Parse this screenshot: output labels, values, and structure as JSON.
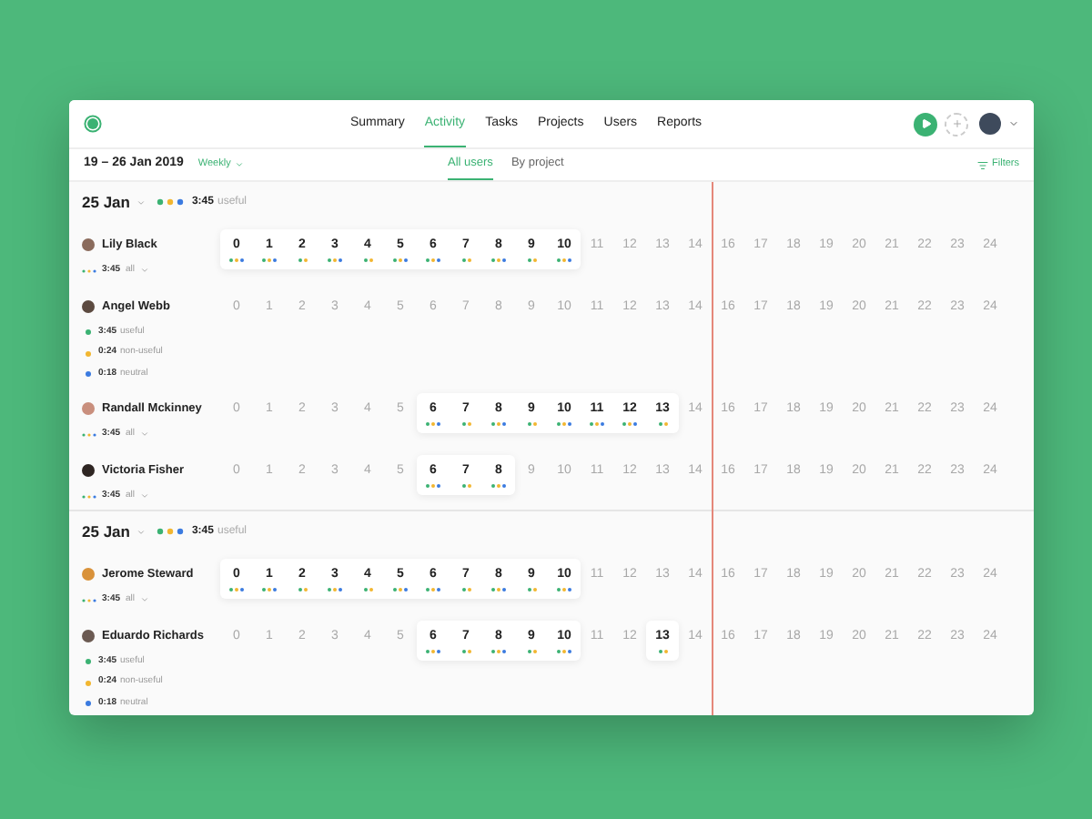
{
  "nav": {
    "tabs": [
      {
        "label": "Summary",
        "selected": false
      },
      {
        "label": "Activity",
        "selected": true
      },
      {
        "label": "Tasks",
        "selected": false
      },
      {
        "label": "Projects",
        "selected": false
      },
      {
        "label": "Users",
        "selected": false
      },
      {
        "label": "Reports",
        "selected": false
      }
    ]
  },
  "toolbar": {
    "date_range": "19 – 26 Jan 2019",
    "period": "Weekly",
    "view_tabs": [
      {
        "label": "All users",
        "selected": true
      },
      {
        "label": "By project",
        "selected": false
      }
    ],
    "filters": "Filters"
  },
  "groups": [
    {
      "date": "25 Jan",
      "total": "3:45",
      "total_label": "useful",
      "users": [
        {
          "name": "Lily Black",
          "expanded": false,
          "summary": {
            "time": "3:45",
            "label": "all"
          },
          "hours": [
            {
              "label": "0",
              "active": true,
              "dots": [
                {
                  "color": "#3bb273"
                },
                {
                  "color": "#f2b630"
                },
                {
                  "color": "#3b7be0"
                }
              ]
            },
            {
              "label": "1",
              "active": true,
              "dots": [
                {
                  "color": "#3bb273"
                },
                {
                  "color": "#f2b630"
                },
                {
                  "color": "#3b7be0"
                }
              ]
            },
            {
              "label": "2",
              "active": true,
              "dots": [
                {
                  "color": "#3bb273"
                },
                {
                  "color": "#f2b630"
                }
              ]
            },
            {
              "label": "3",
              "active": true,
              "dots": [
                {
                  "color": "#3bb273"
                },
                {
                  "color": "#f2b630"
                },
                {
                  "color": "#3b7be0"
                }
              ]
            },
            {
              "label": "4",
              "active": true,
              "dots": [
                {
                  "color": "#3bb273"
                },
                {
                  "color": "#f2b630"
                }
              ]
            },
            {
              "label": "5",
              "active": true,
              "dots": [
                {
                  "color": "#3bb273"
                },
                {
                  "color": "#f2b630"
                },
                {
                  "color": "#3b7be0"
                }
              ]
            },
            {
              "label": "6",
              "active": true,
              "dots": [
                {
                  "color": "#3bb273"
                },
                {
                  "color": "#f2b630"
                },
                {
                  "color": "#3b7be0"
                }
              ]
            },
            {
              "label": "7",
              "active": true,
              "dots": [
                {
                  "color": "#3bb273"
                },
                {
                  "color": "#f2b630"
                }
              ]
            },
            {
              "label": "8",
              "active": true,
              "dots": [
                {
                  "color": "#3bb273"
                },
                {
                  "color": "#f2b630"
                },
                {
                  "color": "#3b7be0"
                }
              ]
            },
            {
              "label": "9",
              "active": true,
              "dots": [
                {
                  "color": "#3bb273"
                },
                {
                  "color": "#f2b630"
                }
              ]
            },
            {
              "label": "10",
              "active": true,
              "dots": [
                {
                  "color": "#3bb273"
                },
                {
                  "color": "#f2b630"
                },
                {
                  "color": "#3b7be0"
                }
              ]
            },
            {
              "label": "11",
              "active": false
            },
            {
              "label": "12",
              "active": false
            },
            {
              "label": "13",
              "active": false
            },
            {
              "label": "14",
              "active": false
            },
            {
              "label": "16",
              "active": false
            },
            {
              "label": "17",
              "active": false
            },
            {
              "label": "18",
              "active": false
            },
            {
              "label": "19",
              "active": false
            },
            {
              "label": "20",
              "active": false
            },
            {
              "label": "21",
              "active": false
            },
            {
              "label": "22",
              "active": false
            },
            {
              "label": "23",
              "active": false
            },
            {
              "label": "24",
              "active": false
            }
          ]
        },
        {
          "name": "Angel Webb",
          "expanded": true,
          "breakdown": [
            {
              "time": "3:45",
              "label": "useful",
              "color": "#3bb273"
            },
            {
              "time": "0:24",
              "label": "non-useful",
              "color": "#f2b630"
            },
            {
              "time": "0:18",
              "label": "neutral",
              "color": "#3b7be0"
            }
          ],
          "hours": [
            {
              "label": "0",
              "active": false
            },
            {
              "label": "1",
              "active": false
            },
            {
              "label": "2",
              "active": false
            },
            {
              "label": "3",
              "active": false
            },
            {
              "label": "4",
              "active": false
            },
            {
              "label": "5",
              "active": false
            },
            {
              "label": "6",
              "active": false
            },
            {
              "label": "7",
              "active": false
            },
            {
              "label": "8",
              "active": false
            },
            {
              "label": "9",
              "active": false
            },
            {
              "label": "10",
              "active": false
            },
            {
              "label": "11",
              "active": false
            },
            {
              "label": "12",
              "active": false
            },
            {
              "label": "13",
              "active": false
            },
            {
              "label": "14",
              "active": false
            },
            {
              "label": "16",
              "active": false
            },
            {
              "label": "17",
              "active": false
            },
            {
              "label": "18",
              "active": false
            },
            {
              "label": "19",
              "active": false
            },
            {
              "label": "20",
              "active": false
            },
            {
              "label": "21",
              "active": false
            },
            {
              "label": "22",
              "active": false
            },
            {
              "label": "23",
              "active": false
            },
            {
              "label": "24",
              "active": false
            }
          ]
        },
        {
          "name": "Randall Mckinney",
          "expanded": false,
          "summary": {
            "time": "3:45",
            "label": "all"
          },
          "hours": [
            {
              "label": "0",
              "active": false
            },
            {
              "label": "1",
              "active": false
            },
            {
              "label": "2",
              "active": false
            },
            {
              "label": "3",
              "active": false
            },
            {
              "label": "4",
              "active": false
            },
            {
              "label": "5",
              "active": false
            },
            {
              "label": "6",
              "active": true,
              "dots": [
                {
                  "color": "#3bb273"
                },
                {
                  "color": "#f2b630"
                },
                {
                  "color": "#3b7be0"
                }
              ]
            },
            {
              "label": "7",
              "active": true,
              "dots": [
                {
                  "color": "#3bb273"
                },
                {
                  "color": "#f2b630"
                }
              ]
            },
            {
              "label": "8",
              "active": true,
              "dots": [
                {
                  "color": "#3bb273"
                },
                {
                  "color": "#f2b630"
                },
                {
                  "color": "#3b7be0"
                }
              ]
            },
            {
              "label": "9",
              "active": true,
              "dots": [
                {
                  "color": "#3bb273"
                },
                {
                  "color": "#f2b630"
                }
              ]
            },
            {
              "label": "10",
              "active": true,
              "dots": [
                {
                  "color": "#3bb273"
                },
                {
                  "color": "#f2b630"
                },
                {
                  "color": "#3b7be0"
                }
              ]
            },
            {
              "label": "11",
              "active": true,
              "dots": [
                {
                  "color": "#3bb273"
                },
                {
                  "color": "#f2b630"
                },
                {
                  "color": "#3b7be0"
                }
              ]
            },
            {
              "label": "12",
              "active": true,
              "dots": [
                {
                  "color": "#3bb273"
                },
                {
                  "color": "#f2b630"
                },
                {
                  "color": "#3b7be0"
                }
              ]
            },
            {
              "label": "13",
              "active": true,
              "dots": [
                {
                  "color": "#3bb273"
                },
                {
                  "color": "#f2b630"
                }
              ]
            },
            {
              "label": "14",
              "active": false
            },
            {
              "label": "16",
              "active": false
            },
            {
              "label": "17",
              "active": false
            },
            {
              "label": "18",
              "active": false
            },
            {
              "label": "19",
              "active": false
            },
            {
              "label": "20",
              "active": false
            },
            {
              "label": "21",
              "active": false
            },
            {
              "label": "22",
              "active": false
            },
            {
              "label": "23",
              "active": false
            },
            {
              "label": "24",
              "active": false
            }
          ]
        },
        {
          "name": "Victoria Fisher",
          "expanded": false,
          "summary": {
            "time": "3:45",
            "label": "all"
          },
          "hours": [
            {
              "label": "0",
              "active": false
            },
            {
              "label": "1",
              "active": false
            },
            {
              "label": "2",
              "active": false
            },
            {
              "label": "3",
              "active": false
            },
            {
              "label": "4",
              "active": false
            },
            {
              "label": "5",
              "active": false
            },
            {
              "label": "6",
              "active": true,
              "dots": [
                {
                  "color": "#3bb273"
                },
                {
                  "color": "#f2b630"
                },
                {
                  "color": "#3b7be0"
                }
              ]
            },
            {
              "label": "7",
              "active": true,
              "dots": [
                {
                  "color": "#3bb273"
                },
                {
                  "color": "#f2b630"
                }
              ]
            },
            {
              "label": "8",
              "active": true,
              "dots": [
                {
                  "color": "#3bb273"
                },
                {
                  "color": "#f2b630"
                },
                {
                  "color": "#3b7be0"
                }
              ]
            },
            {
              "label": "9",
              "active": false
            },
            {
              "label": "10",
              "active": false
            },
            {
              "label": "11",
              "active": false
            },
            {
              "label": "12",
              "active": false
            },
            {
              "label": "13",
              "active": false
            },
            {
              "label": "14",
              "active": false
            },
            {
              "label": "16",
              "active": false
            },
            {
              "label": "17",
              "active": false
            },
            {
              "label": "18",
              "active": false
            },
            {
              "label": "19",
              "active": false
            },
            {
              "label": "20",
              "active": false
            },
            {
              "label": "21",
              "active": false
            },
            {
              "label": "22",
              "active": false
            },
            {
              "label": "23",
              "active": false
            },
            {
              "label": "24",
              "active": false
            }
          ]
        }
      ]
    },
    {
      "date": "25 Jan",
      "total": "3:45",
      "total_label": "useful",
      "users": [
        {
          "name": "Jerome Steward",
          "expanded": false,
          "summary": {
            "time": "3:45",
            "label": "all"
          },
          "hours": [
            {
              "label": "0",
              "active": true,
              "dots": [
                {
                  "color": "#3bb273"
                },
                {
                  "color": "#f2b630"
                },
                {
                  "color": "#3b7be0"
                }
              ]
            },
            {
              "label": "1",
              "active": true,
              "dots": [
                {
                  "color": "#3bb273"
                },
                {
                  "color": "#f2b630"
                },
                {
                  "color": "#3b7be0"
                }
              ]
            },
            {
              "label": "2",
              "active": true,
              "dots": [
                {
                  "color": "#3bb273"
                },
                {
                  "color": "#f2b630"
                }
              ]
            },
            {
              "label": "3",
              "active": true,
              "dots": [
                {
                  "color": "#3bb273"
                },
                {
                  "color": "#f2b630"
                },
                {
                  "color": "#3b7be0"
                }
              ]
            },
            {
              "label": "4",
              "active": true,
              "dots": [
                {
                  "color": "#3bb273"
                },
                {
                  "color": "#f2b630"
                }
              ]
            },
            {
              "label": "5",
              "active": true,
              "dots": [
                {
                  "color": "#3bb273"
                },
                {
                  "color": "#f2b630"
                },
                {
                  "color": "#3b7be0"
                }
              ]
            },
            {
              "label": "6",
              "active": true,
              "dots": [
                {
                  "color": "#3bb273"
                },
                {
                  "color": "#f2b630"
                },
                {
                  "color": "#3b7be0"
                }
              ]
            },
            {
              "label": "7",
              "active": true,
              "dots": [
                {
                  "color": "#3bb273"
                },
                {
                  "color": "#f2b630"
                }
              ]
            },
            {
              "label": "8",
              "active": true,
              "dots": [
                {
                  "color": "#3bb273"
                },
                {
                  "color": "#f2b630"
                },
                {
                  "color": "#3b7be0"
                }
              ]
            },
            {
              "label": "9",
              "active": true,
              "dots": [
                {
                  "color": "#3bb273"
                },
                {
                  "color": "#f2b630"
                }
              ]
            },
            {
              "label": "10",
              "active": true,
              "dots": [
                {
                  "color": "#3bb273"
                },
                {
                  "color": "#f2b630"
                },
                {
                  "color": "#3b7be0"
                }
              ]
            },
            {
              "label": "11",
              "active": false
            },
            {
              "label": "12",
              "active": false
            },
            {
              "label": "13",
              "active": false
            },
            {
              "label": "14",
              "active": false
            },
            {
              "label": "16",
              "active": false
            },
            {
              "label": "17",
              "active": false
            },
            {
              "label": "18",
              "active": false
            },
            {
              "label": "19",
              "active": false
            },
            {
              "label": "20",
              "active": false
            },
            {
              "label": "21",
              "active": false
            },
            {
              "label": "22",
              "active": false
            },
            {
              "label": "23",
              "active": false
            },
            {
              "label": "24",
              "active": false
            }
          ]
        },
        {
          "name": "Eduardo Richards",
          "expanded": true,
          "breakdown": [
            {
              "time": "3:45",
              "label": "useful",
              "color": "#3bb273"
            },
            {
              "time": "0:24",
              "label": "non-useful",
              "color": "#f2b630"
            },
            {
              "time": "0:18",
              "label": "neutral",
              "color": "#3b7be0"
            }
          ],
          "hours": [
            {
              "label": "0",
              "active": false
            },
            {
              "label": "1",
              "active": false
            },
            {
              "label": "2",
              "active": false
            },
            {
              "label": "3",
              "active": false
            },
            {
              "label": "4",
              "active": false
            },
            {
              "label": "5",
              "active": false
            },
            {
              "label": "6",
              "active": true,
              "dots": [
                {
                  "color": "#3bb273"
                },
                {
                  "color": "#f2b630"
                },
                {
                  "color": "#3b7be0"
                }
              ]
            },
            {
              "label": "7",
              "active": true,
              "dots": [
                {
                  "color": "#3bb273"
                },
                {
                  "color": "#f2b630"
                }
              ]
            },
            {
              "label": "8",
              "active": true,
              "dots": [
                {
                  "color": "#3bb273"
                },
                {
                  "color": "#f2b630"
                },
                {
                  "color": "#3b7be0"
                }
              ]
            },
            {
              "label": "9",
              "active": true,
              "dots": [
                {
                  "color": "#3bb273"
                },
                {
                  "color": "#f2b630"
                }
              ]
            },
            {
              "label": "10",
              "active": true,
              "dots": [
                {
                  "color": "#3bb273"
                },
                {
                  "color": "#f2b630"
                },
                {
                  "color": "#3b7be0"
                }
              ]
            },
            {
              "label": "11",
              "active": false
            },
            {
              "label": "12",
              "active": false
            },
            {
              "label": "13",
              "active": true,
              "dots": [
                {
                  "color": "#3bb273"
                },
                {
                  "color": "#f2b630"
                }
              ]
            },
            {
              "label": "14",
              "active": false
            },
            {
              "label": "16",
              "active": false
            },
            {
              "label": "17",
              "active": false
            },
            {
              "label": "18",
              "active": false
            },
            {
              "label": "19",
              "active": false
            },
            {
              "label": "20",
              "active": false
            },
            {
              "label": "21",
              "active": false
            },
            {
              "label": "22",
              "active": false
            },
            {
              "label": "23",
              "active": false
            },
            {
              "label": "24",
              "active": false
            }
          ]
        }
      ]
    }
  ]
}
